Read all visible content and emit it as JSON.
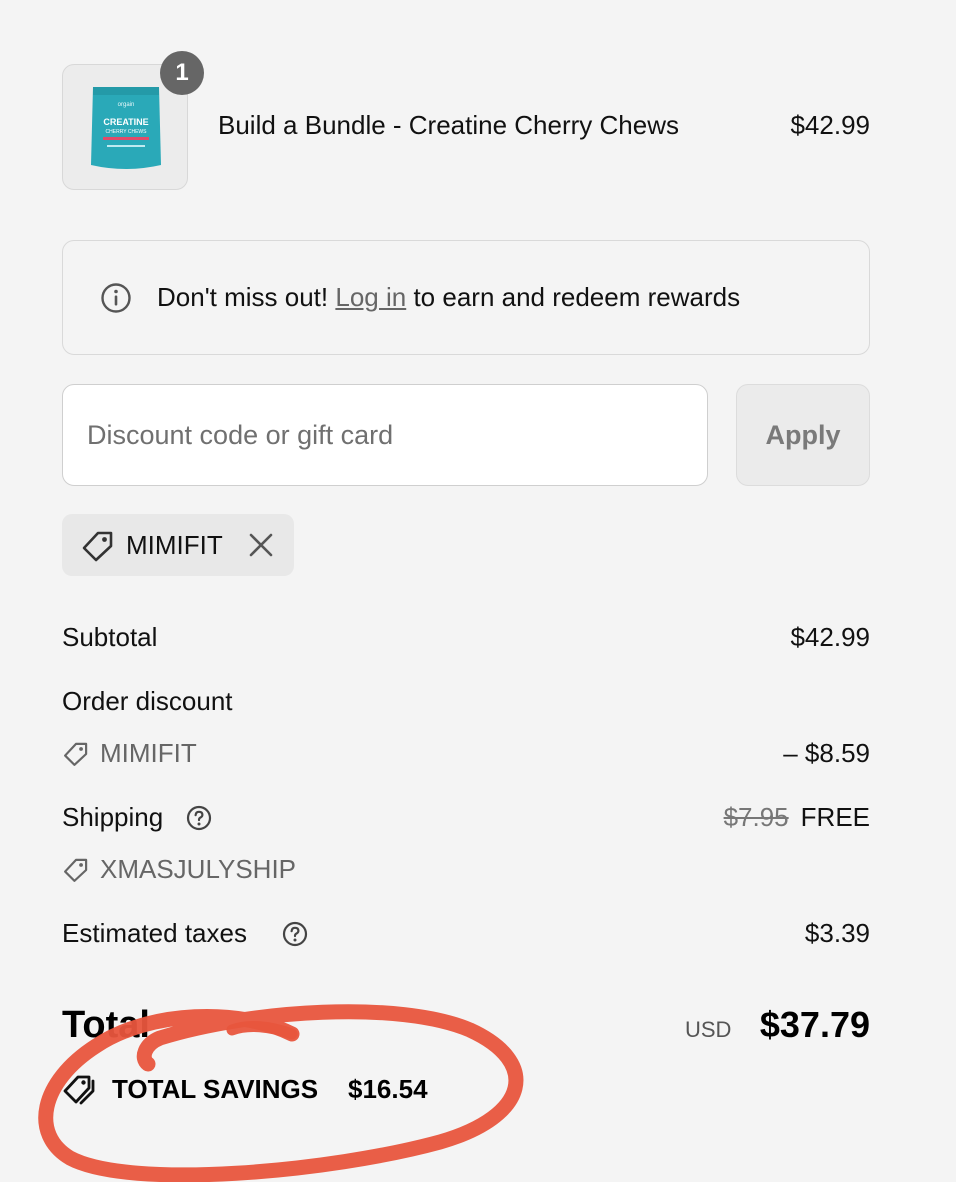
{
  "product": {
    "quantity": "1",
    "name": "Build a Bundle - Creatine Cherry Chews",
    "price": "$42.99",
    "image_brand": "orgain",
    "image_title": "CREATINE",
    "image_subtitle": "CHERRY CHEWS",
    "image_color": "#2aa9b8"
  },
  "rewards": {
    "prefix": "Don't miss out!",
    "link": "Log in",
    "suffix": "to earn and redeem rewards"
  },
  "discount": {
    "placeholder": "Discount code or gift card",
    "apply_label": "Apply",
    "applied_code": "MIMIFIT"
  },
  "summary": {
    "subtotal_label": "Subtotal",
    "subtotal_value": "$42.99",
    "order_discount_label": "Order discount",
    "order_discount_code": "MIMIFIT",
    "order_discount_value": "– $8.59",
    "shipping_label": "Shipping",
    "shipping_original": "$7.95",
    "shipping_value": "FREE",
    "shipping_code": "XMASJULYSHIP",
    "taxes_label": "Estimated taxes",
    "taxes_value": "$3.39",
    "total_label": "Total",
    "currency": "USD",
    "total_value": "$37.79",
    "savings_label": "TOTAL SAVINGS",
    "savings_value": "$16.54"
  },
  "colors": {
    "background": "#f4f4f4",
    "annotation_circle": "#e8553d",
    "badge": "#666666"
  }
}
